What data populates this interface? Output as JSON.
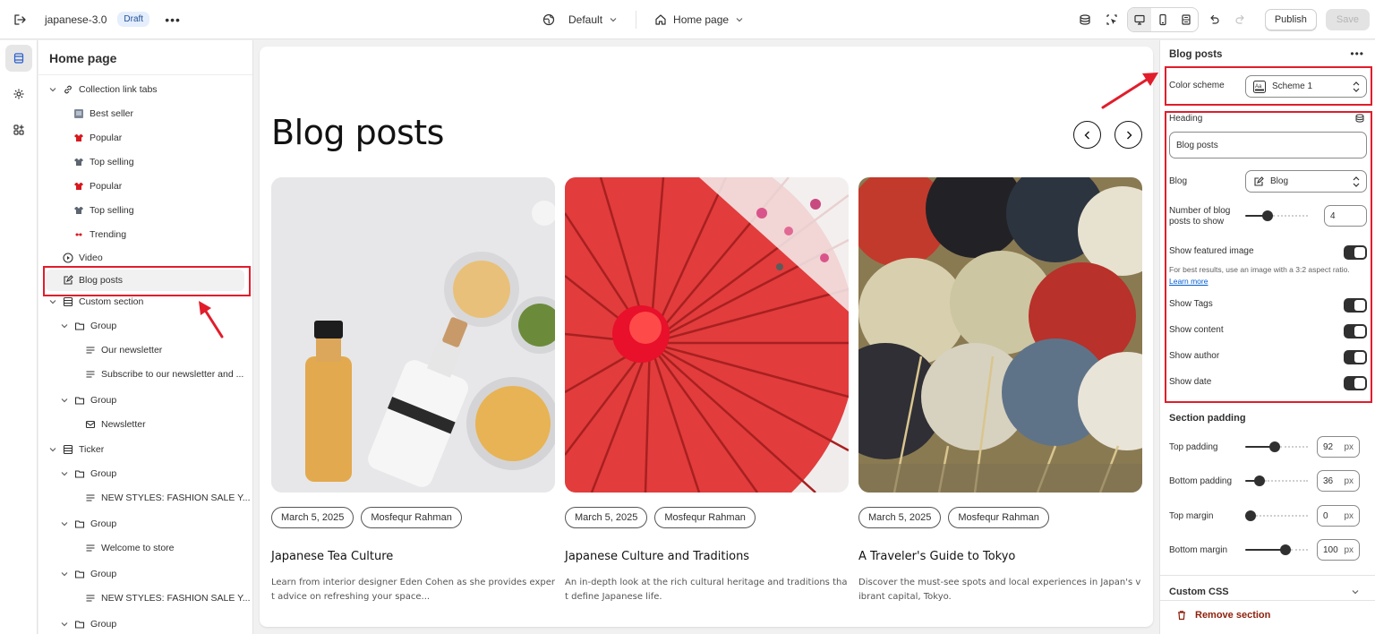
{
  "topbar": {
    "theme_name": "japanese-3.0",
    "status_badge": "Draft",
    "template": "Default",
    "page": "Home page",
    "publish": "Publish",
    "save": "Save",
    "icons": [
      "exit-icon",
      "more-icon",
      "globe-icon",
      "home-icon",
      "chevron-down-icon",
      "database-icon",
      "inspector-icon",
      "desktop-icon",
      "mobile-icon",
      "fullwidth-icon",
      "undo-icon",
      "redo-icon"
    ]
  },
  "sidebar": {
    "title": "Home page",
    "items": [
      {
        "label": "Collection link tabs",
        "icon": "link-icon"
      },
      {
        "label": "Best seller",
        "icon": "product-thumb-icon"
      },
      {
        "label": "Popular",
        "icon": "red-shirt-icon"
      },
      {
        "label": "Top selling",
        "icon": "grey-shirt-icon"
      },
      {
        "label": "Popular",
        "icon": "red-shirt-icon"
      },
      {
        "label": "Top selling",
        "icon": "grey-shirt-icon"
      },
      {
        "label": "Trending",
        "icon": "red-item-icon"
      },
      {
        "label": "Video",
        "icon": "play-icon"
      },
      {
        "label": "Blog posts",
        "icon": "edit-icon"
      },
      {
        "label": "Custom section",
        "icon": "section-icon"
      },
      {
        "label": "Group",
        "icon": "folder-icon"
      },
      {
        "label": "Our newsletter",
        "icon": "text-icon"
      },
      {
        "label": "Subscribe to our newsletter and ...",
        "icon": "text-icon"
      },
      {
        "label": "Group",
        "icon": "folder-icon"
      },
      {
        "label": "Newsletter",
        "icon": "email-icon"
      },
      {
        "label": "Ticker",
        "icon": "section-icon"
      },
      {
        "label": "Group",
        "icon": "folder-icon"
      },
      {
        "label": "NEW STYLES: FASHION SALE Y...",
        "icon": "text-icon"
      },
      {
        "label": "Group",
        "icon": "folder-icon"
      },
      {
        "label": "Welcome to store",
        "icon": "text-icon"
      },
      {
        "label": "Group",
        "icon": "folder-icon"
      },
      {
        "label": "NEW STYLES: FASHION SALE Y...",
        "icon": "text-icon"
      },
      {
        "label": "Group",
        "icon": "folder-icon"
      }
    ]
  },
  "preview": {
    "heading": "Blog posts",
    "posts": [
      {
        "date": "March 5, 2025",
        "author": "Mosfequr Rahman",
        "title": "Japanese Tea Culture",
        "excerpt": "Learn from interior designer Eden Cohen as she provides expert advice on refreshing your space..."
      },
      {
        "date": "March 5, 2025",
        "author": "Mosfequr Rahman",
        "title": "Japanese Culture and Traditions",
        "excerpt": "An in-depth look at the rich cultural heritage and traditions that define Japanese life."
      },
      {
        "date": "March 5, 2025",
        "author": "Mosfequr Rahman",
        "title": "A Traveler's Guide to Tokyo",
        "excerpt": "Discover the must-see spots and local experiences in Japan's vibrant capital, Tokyo."
      }
    ]
  },
  "settings": {
    "title": "Blog posts",
    "color_scheme_label": "Color scheme",
    "color_scheme_value": "Scheme 1",
    "heading_label": "Heading",
    "heading_value": "Blog posts",
    "blog_label": "Blog",
    "blog_value": "Blog",
    "num_posts_label": "Number of blog posts to show",
    "num_posts_value": "4",
    "num_posts_level": 0.33,
    "show_featured_label": "Show featured image",
    "help_text": "For best results, use an image with a 3:2 aspect ratio.",
    "learn_more": "Learn more",
    "show_tags_label": "Show Tags",
    "show_content_label": "Show content",
    "show_author_label": "Show author",
    "show_date_label": "Show date",
    "toggles": {
      "featured": true,
      "tags": true,
      "content": true,
      "author": true,
      "date": true
    },
    "section_padding_label": "Section padding",
    "top_padding_label": "Top padding",
    "top_padding_value": "92",
    "top_padding_level": 0.46,
    "bottom_padding_label": "Bottom padding",
    "bottom_padding_value": "36",
    "bottom_padding_level": 0.18,
    "top_margin_label": "Top margin",
    "top_margin_value": "0",
    "top_margin_level": 0,
    "bottom_margin_label": "Bottom margin",
    "bottom_margin_value": "100",
    "bottom_margin_level": 0.67,
    "unit": "px",
    "custom_css_label": "Custom CSS",
    "remove_label": "Remove section"
  },
  "colors": {
    "highlight": "#e11d2b",
    "accent_text": "#303030",
    "danger": "#8e1f0b",
    "link": "#005bd3"
  }
}
